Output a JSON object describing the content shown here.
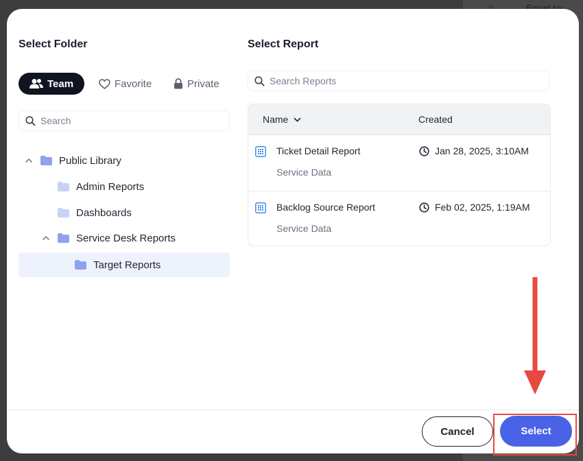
{
  "background": {
    "equal_to": "Equal to:"
  },
  "folder_panel": {
    "title": "Select Folder",
    "tabs": [
      {
        "label": "Team",
        "icon": "users-icon",
        "active": true
      },
      {
        "label": "Favorite",
        "icon": "heart-icon",
        "active": false
      },
      {
        "label": "Private",
        "icon": "lock-icon",
        "active": false
      }
    ],
    "search_placeholder": "Search",
    "tree": [
      {
        "label": "Public Library",
        "level": 0,
        "expanded": true
      },
      {
        "label": "Admin Reports",
        "level": 1
      },
      {
        "label": "Dashboards",
        "level": 1
      },
      {
        "label": "Service Desk Reports",
        "level": 1,
        "expanded": true
      },
      {
        "label": "Target Reports",
        "level": 2,
        "selected": true
      }
    ]
  },
  "report_panel": {
    "title": "Select Report",
    "search_placeholder": "Search Reports",
    "columns": {
      "name": "Name",
      "created": "Created"
    },
    "rows": [
      {
        "name": "Ticket Detail Report",
        "source": "Service Data",
        "created": "Jan 28, 2025, 3:10AM"
      },
      {
        "name": "Backlog Source Report",
        "source": "Service Data",
        "created": "Feb 02, 2025, 1:19AM"
      }
    ]
  },
  "footer": {
    "cancel_label": "Cancel",
    "select_label": "Select"
  },
  "colors": {
    "accent": "#4a63e6",
    "annotation": "#e8483f",
    "folder": "#8fa2f0",
    "tab_active": "#0f1420"
  }
}
